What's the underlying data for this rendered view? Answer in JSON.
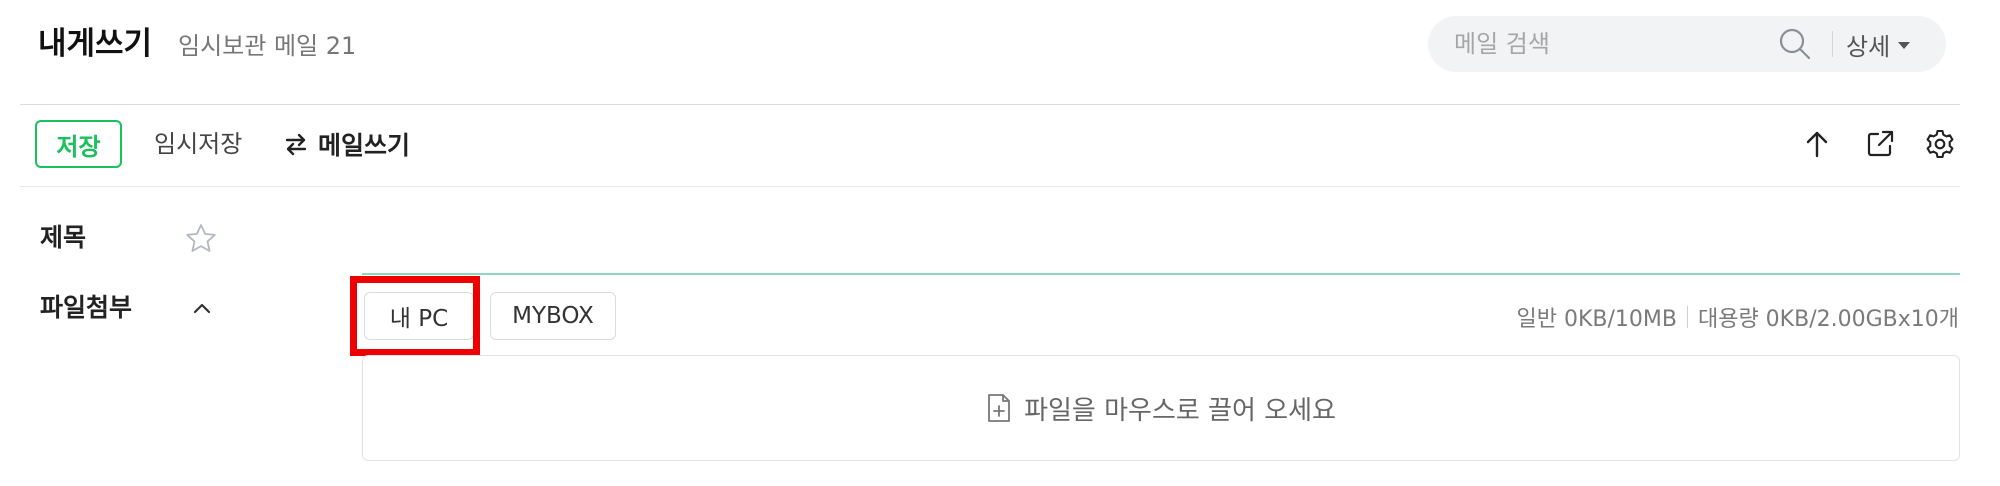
{
  "header": {
    "title": "내게쓰기",
    "draft_info": "임시보관 메일 21",
    "search": {
      "placeholder": "메일 검색",
      "detail_label": "상세"
    }
  },
  "toolbar": {
    "save_label": "저장",
    "temp_save_label": "임시저장",
    "compose_toggle_label": "메일쓰기",
    "icons": [
      "arrow-up-icon",
      "popout-icon",
      "gear-icon"
    ]
  },
  "fields": {
    "subject_label": "제목",
    "attachment_label": "파일첨부"
  },
  "attachment": {
    "my_pc_label": "내 PC",
    "mybox_label": "MYBOX",
    "general_capacity": "일반 0KB/10MB",
    "large_capacity": "대용량 0KB/2.00GBx10개",
    "drop_hint": "파일을 마우스로 끌어 오세요"
  },
  "colors": {
    "accent": "#19c15c",
    "highlight": "#ee0000",
    "subject_underline": "#8fd6bd"
  }
}
